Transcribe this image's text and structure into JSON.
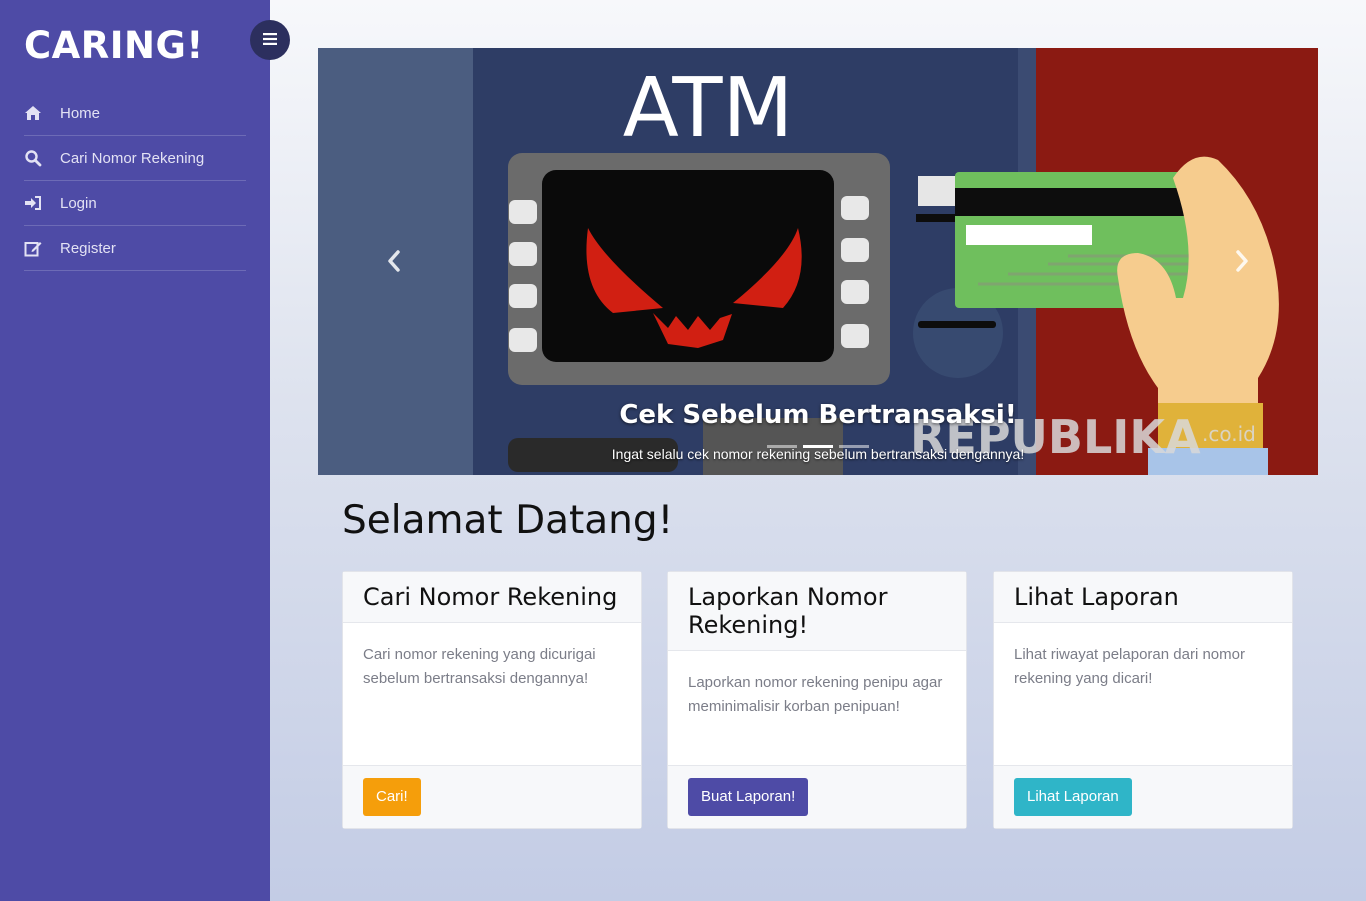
{
  "sidebar": {
    "brand": "CARING!",
    "menu_icon": "hamburger-icon",
    "items": [
      {
        "label": "Home",
        "icon": "home-icon"
      },
      {
        "label": "Cari Nomor Rekening",
        "icon": "search-icon"
      },
      {
        "label": "Login",
        "icon": "sign-in-icon"
      },
      {
        "label": "Register",
        "icon": "edit-icon"
      }
    ]
  },
  "carousel": {
    "image_text": "ATM",
    "watermark": "REPUBLIKA",
    "watermark_suffix": ".co.id",
    "caption_title": "Cek Sebelum Bertransaksi!",
    "caption_text": "Ingat selalu cek nomor rekening sebelum bertransaksi dengannya!",
    "slides_count": 3,
    "active_slide": 2
  },
  "main": {
    "welcome": "Selamat Datang!"
  },
  "cards": [
    {
      "title": "Cari Nomor Rekening",
      "text": "Cari nomor rekening yang dicurigai sebelum bertransaksi dengannya!",
      "button": "Cari!",
      "button_color": "#f59e0b"
    },
    {
      "title": "Laporkan Nomor Rekening!",
      "text": "Laporkan nomor rekening penipu agar meminimalisir korban penipuan!",
      "button": "Buat Laporan!",
      "button_color": "#4e4ba6"
    },
    {
      "title": "Lihat Laporan",
      "text": "Lihat riwayat pelaporan dari nomor rekening yang dicari!",
      "button": "Lihat Laporan",
      "button_color": "#2fb5c8"
    }
  ],
  "colors": {
    "sidebar": "#4e4ba6",
    "toggle": "#2c2f5e"
  }
}
